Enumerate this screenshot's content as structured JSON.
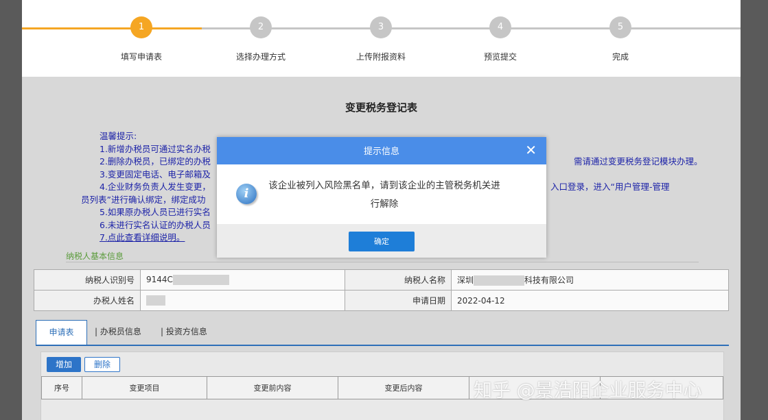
{
  "steps": [
    {
      "num": "1",
      "label": "填写申请表"
    },
    {
      "num": "2",
      "label": "选择办理方式"
    },
    {
      "num": "3",
      "label": "上传附报资料"
    },
    {
      "num": "4",
      "label": "预览提交"
    },
    {
      "num": "5",
      "label": "完成"
    }
  ],
  "colors": {
    "active_step": "#f5a623",
    "inactive_step": "#c6c6c6",
    "accent": "#2d74c8",
    "dialog_header": "#4a8de8"
  },
  "form": {
    "title": "变更税务登记表"
  },
  "tips": {
    "heading": "温馨提示:",
    "line1_left": "1.新增办税员可通过实名办税",
    "line2_left": "2.删除办税员，已绑定的办税",
    "line2_right": "需请通过变更税务登记模块办理。",
    "line3_left": "3.变更固定电话、电子邮箱及",
    "line4_left": "4.企业财务负责人发生变更，",
    "line4_right": "入口登录，进入“用户管理-管理",
    "line4b_left": "员列表”进行确认绑定，绑定成功",
    "line5_left": "5.如果原办税人员已进行实名",
    "line6_left": "6.未进行实名认证的办税人员",
    "line7": "7.点此查看详细说明。"
  },
  "basic": {
    "section_title": "纳税人基本信息",
    "tin_label": "纳税人识别号",
    "tin_value": "9144C",
    "name_label": "纳税人名称",
    "name_prefix": "深圳",
    "name_suffix": "科技有限公司",
    "handler_label": "办税人姓名",
    "date_label": "申请日期",
    "date_value": "2022-04-12"
  },
  "tabs": [
    "申请表",
    "办税员信息",
    "投资方信息"
  ],
  "panel": {
    "add_label": "增加",
    "delete_label": "删除",
    "columns": [
      "序号",
      "变更项目",
      "变更前内容",
      "变更后内容",
      "",
      ""
    ]
  },
  "dialog": {
    "title": "提示信息",
    "close_glyph": "✕",
    "icon_glyph": "i",
    "message": "该企业被列入风险黑名单，请到该企业的主管税务机关进行解除",
    "ok_label": "确定"
  },
  "watermark": "知乎 @景浩阳企业服务中心"
}
